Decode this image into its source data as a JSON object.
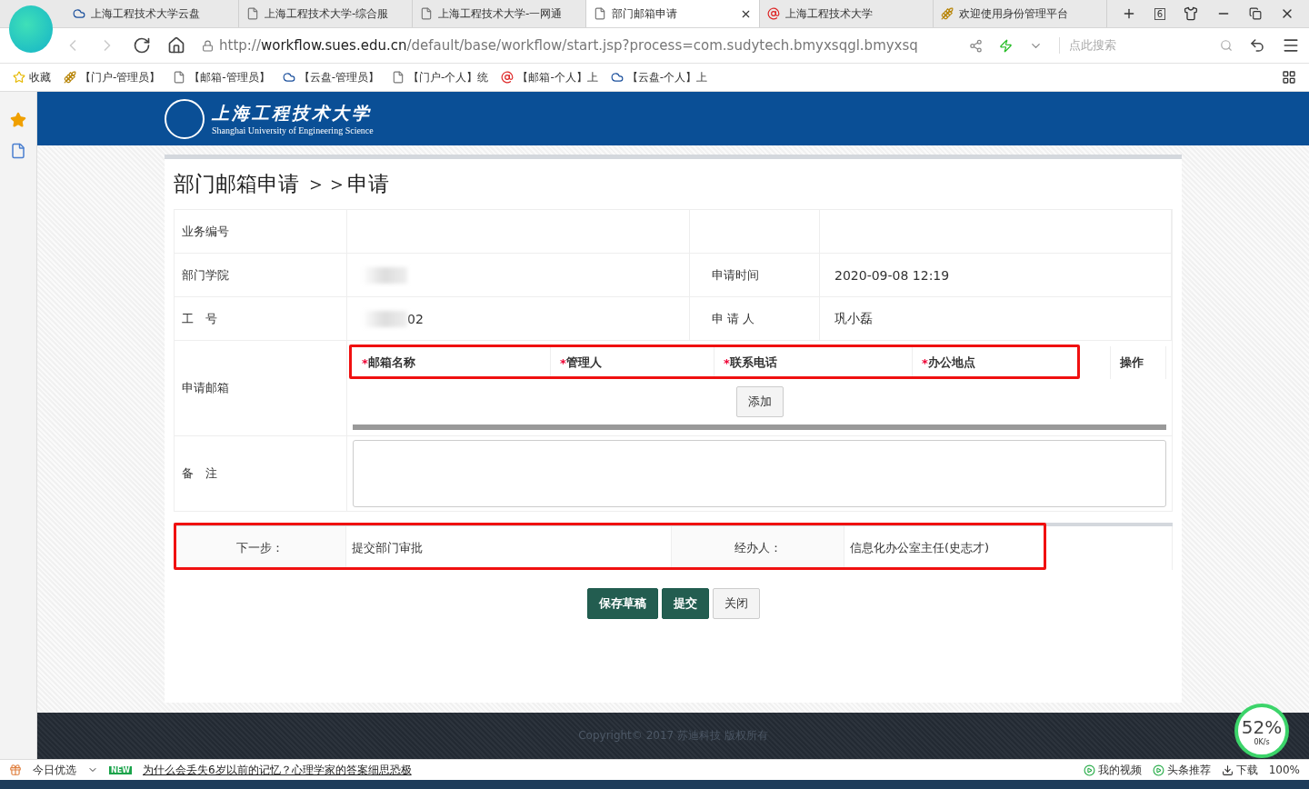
{
  "browser": {
    "tabs": [
      {
        "title": "上海工程技术大学云盘",
        "selected": false
      },
      {
        "title": "上海工程技术大学-综合服",
        "selected": false
      },
      {
        "title": "上海工程技术大学-一网通",
        "selected": false
      },
      {
        "title": "部门邮箱申请",
        "selected": true
      },
      {
        "title": "上海工程技术大学",
        "selected": false
      },
      {
        "title": "欢迎使用身份管理平台",
        "selected": false
      }
    ],
    "tab_count": "6",
    "url_prefix": "http://",
    "url_host": "workflow.sues.edu.cn",
    "url_path": "/default/base/workflow/start.jsp?process=com.sudytech.bmyxsqgl.bmyxsq",
    "search": {
      "placeholder": "点此搜索"
    },
    "bookmarks": [
      {
        "label": "收藏"
      },
      {
        "label": "【门户-管理员】"
      },
      {
        "label": "【邮箱-管理员】"
      },
      {
        "label": "【云盘-管理员】"
      },
      {
        "label": "【门户-个人】统"
      },
      {
        "label": "【邮箱-个人】上"
      },
      {
        "label": "【云盘-个人】上"
      }
    ]
  },
  "header": {
    "name_cn": "上海工程技术大学",
    "name_en": "Shanghai University of Engineering Science"
  },
  "page_title": "部门邮箱申请 ＞＞申请",
  "form": {
    "rows": [
      {
        "label": "业务编号",
        "value": "",
        "label2": "",
        "value2": ""
      },
      {
        "label": "部门学院",
        "value": "",
        "redacted": true,
        "label2": "申请时间",
        "value2": "2020-09-08 12:19"
      },
      {
        "label": "工　号",
        "value": "02",
        "redacted": true,
        "label2": "申 请 人",
        "value2": "巩小磊"
      }
    ],
    "mailbox": {
      "label": "申请邮箱",
      "columns": [
        {
          "mark": "*",
          "title": "邮箱名称"
        },
        {
          "mark": "*",
          "title": "管理人"
        },
        {
          "mark": "*",
          "title": "联系电话"
        },
        {
          "mark": "*",
          "title": "办公地点"
        },
        {
          "title": "操作"
        }
      ],
      "add_button": "添加"
    },
    "remarks": {
      "label": "备　注"
    },
    "next_step": {
      "label": "下一步：",
      "value": "提交部门审批",
      "handler_label": "经办人：",
      "handler": "信息化办公室主任(史志才)"
    }
  },
  "buttons": [
    {
      "label": "保存草稿",
      "kind": "primary"
    },
    {
      "label": "提交",
      "kind": "primary"
    },
    {
      "label": "关闭",
      "kind": "default"
    }
  ],
  "footer": "Copyright© 2017 苏迪科技 版权所有",
  "status_bar": {
    "left": "今日优选",
    "news_badge": "NEW",
    "news": "为什么会丢失6岁以前的记忆？心理学家的答案细思恐极",
    "items": [
      "我的视频",
      "头条推荐",
      "下载"
    ],
    "zoom": "100%"
  },
  "speed": {
    "percent": "52",
    "unit": "%",
    "rate": "0K/s"
  }
}
